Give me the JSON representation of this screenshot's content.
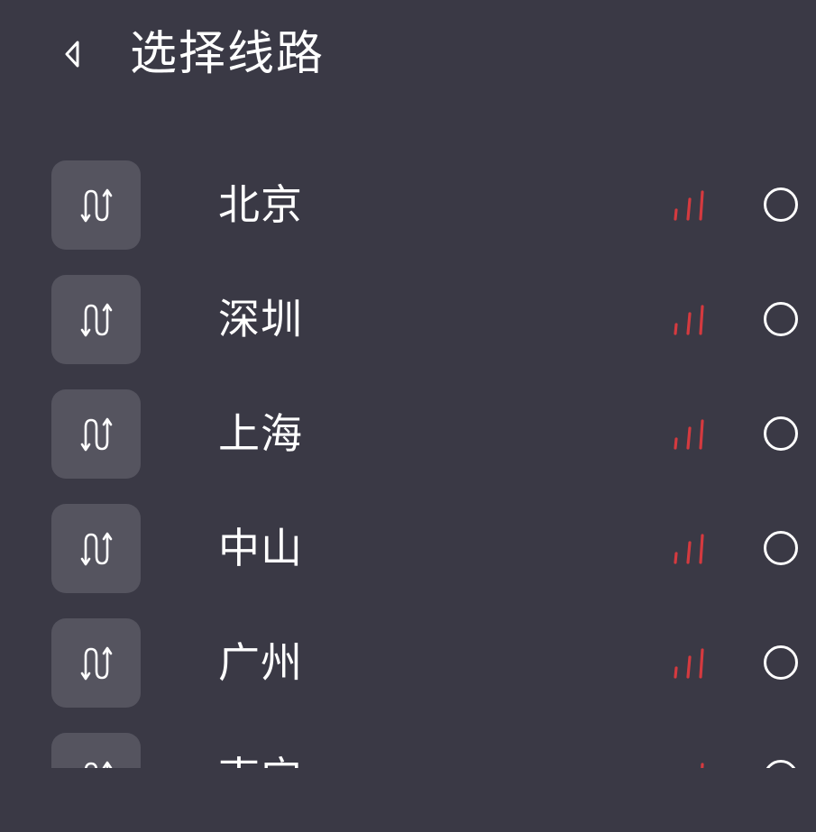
{
  "header": {
    "back_icon": "chevron-left-icon",
    "title": "选择线路"
  },
  "theme": {
    "background": "#3a3945",
    "tile": "#55545f",
    "signal": "#d43a3f",
    "text": "#ffffff"
  },
  "routes": [
    {
      "name": "北京",
      "icon": "route-s-curve-icon",
      "signal_icon": "signal-strength-icon",
      "selected": false
    },
    {
      "name": "深圳",
      "icon": "route-s-curve-icon",
      "signal_icon": "signal-strength-icon",
      "selected": false
    },
    {
      "name": "上海",
      "icon": "route-s-curve-icon",
      "signal_icon": "signal-strength-icon",
      "selected": false
    },
    {
      "name": "中山",
      "icon": "route-s-curve-icon",
      "signal_icon": "signal-strength-icon",
      "selected": false
    },
    {
      "name": "广州",
      "icon": "route-s-curve-icon",
      "signal_icon": "signal-strength-icon",
      "selected": false
    },
    {
      "name": "南宁",
      "icon": "route-s-curve-icon",
      "signal_icon": "signal-strength-icon",
      "selected": false
    }
  ]
}
